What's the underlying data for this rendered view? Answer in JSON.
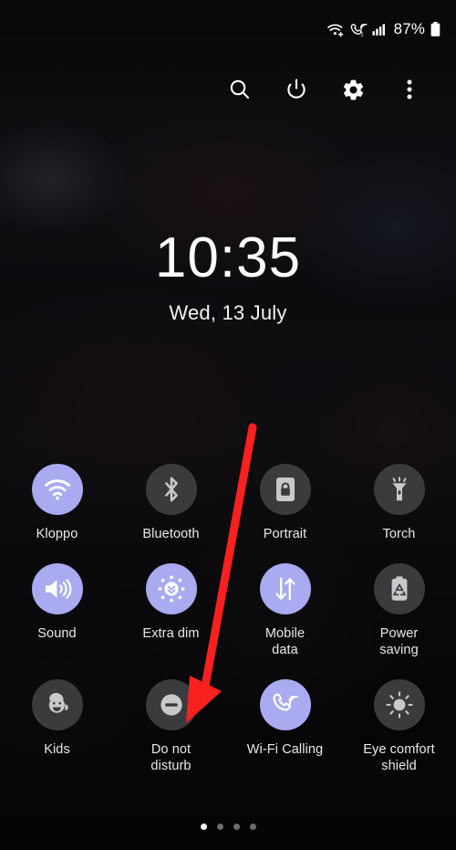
{
  "statusbar": {
    "icons": [
      {
        "name": "wifi-plus-icon",
        "label": "wifi-plus"
      },
      {
        "name": "volte-call-icon",
        "label": "volte-sim1"
      },
      {
        "name": "cellular-signal-icon",
        "label": "signal-bars"
      }
    ],
    "battery_percent": "87%",
    "battery_icon": "battery-icon"
  },
  "toolbar": {
    "buttons": [
      {
        "name": "search-icon",
        "label": "Search"
      },
      {
        "name": "power-icon",
        "label": "Power"
      },
      {
        "name": "settings-gear-icon",
        "label": "Settings"
      },
      {
        "name": "overflow-menu-icon",
        "label": "More options"
      }
    ]
  },
  "clock": {
    "time": "10:35",
    "date": "Wed, 13 July"
  },
  "quick_settings": {
    "tiles": [
      {
        "label": "Kloppo",
        "icon": "wifi-icon",
        "state": "on"
      },
      {
        "label": "Bluetooth",
        "icon": "bluetooth-icon",
        "state": "off"
      },
      {
        "label": "Portrait",
        "icon": "rotation-lock-icon",
        "state": "off"
      },
      {
        "label": "Torch",
        "icon": "flashlight-icon",
        "state": "off"
      },
      {
        "label": "Sound",
        "icon": "speaker-icon",
        "state": "on"
      },
      {
        "label": "Extra dim",
        "icon": "extra-dim-icon",
        "state": "on"
      },
      {
        "label": "Mobile\ndata",
        "icon": "mobile-data-icon",
        "state": "on"
      },
      {
        "label": "Power\nsaving",
        "icon": "power-saving-icon",
        "state": "off"
      },
      {
        "label": "Kids",
        "icon": "kids-face-icon",
        "state": "off"
      },
      {
        "label": "Do not\ndisturb",
        "icon": "do-not-disturb-icon",
        "state": "off"
      },
      {
        "label": "Wi-Fi Calling",
        "icon": "wifi-calling-icon",
        "state": "on"
      },
      {
        "label": "Eye comfort\nshield",
        "icon": "eye-comfort-icon",
        "state": "off"
      }
    ]
  },
  "page_indicator": {
    "total": 4,
    "active_index": 0
  },
  "annotation": {
    "type": "arrow",
    "color": "#f92020",
    "points_to": "Do not disturb",
    "from": [
      277,
      468
    ],
    "to": [
      214,
      786
    ]
  },
  "colors": {
    "tile_active": "#a9aaef",
    "tile_inactive": "#3b3b3e",
    "glyph_active": "#ffffff",
    "glyph_inactive": "#c9c9ca",
    "text": "#e9e9ea",
    "background": "#0a0a0c",
    "annotation_red": "#f92020"
  }
}
